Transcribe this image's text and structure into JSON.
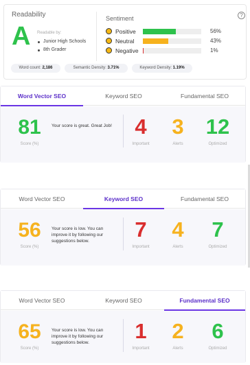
{
  "readability": {
    "title": "Readability",
    "grade": "A",
    "readable_by_label": "Readable by:",
    "audiences": [
      "Junior High Schools",
      "8th Grader"
    ]
  },
  "sentiment": {
    "title": "Sentiment",
    "help_icon": "?",
    "items": [
      {
        "label": "Positive",
        "percent": "56%",
        "value": 56,
        "color": "#2ec24c",
        "icon": "smile-icon"
      },
      {
        "label": "Neutral",
        "percent": "43%",
        "value": 43,
        "color": "#f6b21e",
        "icon": "neutral-face-icon"
      },
      {
        "label": "Negative",
        "percent": "1%",
        "value": 1,
        "color": "#d92e2e",
        "icon": "frown-icon"
      }
    ]
  },
  "stats": {
    "word_count_label": "Word count:",
    "word_count": "2,186",
    "semantic_label": "Semantic Density:",
    "semantic": "3.71%",
    "keyword_label": "Keyword Density:",
    "keyword": "1.19%"
  },
  "panels": [
    {
      "tabs": [
        "Word Vector SEO",
        "Keyword SEO",
        "Fundamental SEO"
      ],
      "active_tab": 0,
      "score": "81",
      "score_label": "Score (%)",
      "message": "Your score is great. Great Job!",
      "metrics": [
        {
          "value": "4",
          "label": "Important"
        },
        {
          "value": "3",
          "label": "Alerts"
        },
        {
          "value": "12",
          "label": "Optimized"
        }
      ]
    },
    {
      "tabs": [
        "Word Vector SEO",
        "Keyword SEO",
        "Fundamental SEO"
      ],
      "active_tab": 1,
      "score": "56",
      "score_label": "Score (%)",
      "message": "Your score is low. You can improve it by following our suggestions below.",
      "metrics": [
        {
          "value": "7",
          "label": "Important"
        },
        {
          "value": "4",
          "label": "Alerts"
        },
        {
          "value": "7",
          "label": "Optimized"
        }
      ]
    },
    {
      "tabs": [
        "Word Vector SEO",
        "Keyword SEO",
        "Fundamental SEO"
      ],
      "active_tab": 2,
      "score": "65",
      "score_label": "Score (%)",
      "message": "Your score is low. You can improve it by following our suggestions below.",
      "metrics": [
        {
          "value": "1",
          "label": "Important"
        },
        {
          "value": "2",
          "label": "Alerts"
        },
        {
          "value": "6",
          "label": "Optimized"
        }
      ]
    }
  ],
  "colors": {
    "accent": "#6a35e4",
    "score_great": "#2ec24c",
    "score_low": "#f6b21e",
    "important": "#d92e2e",
    "alerts": "#f6b21e",
    "optimized": "#2ec24c"
  }
}
